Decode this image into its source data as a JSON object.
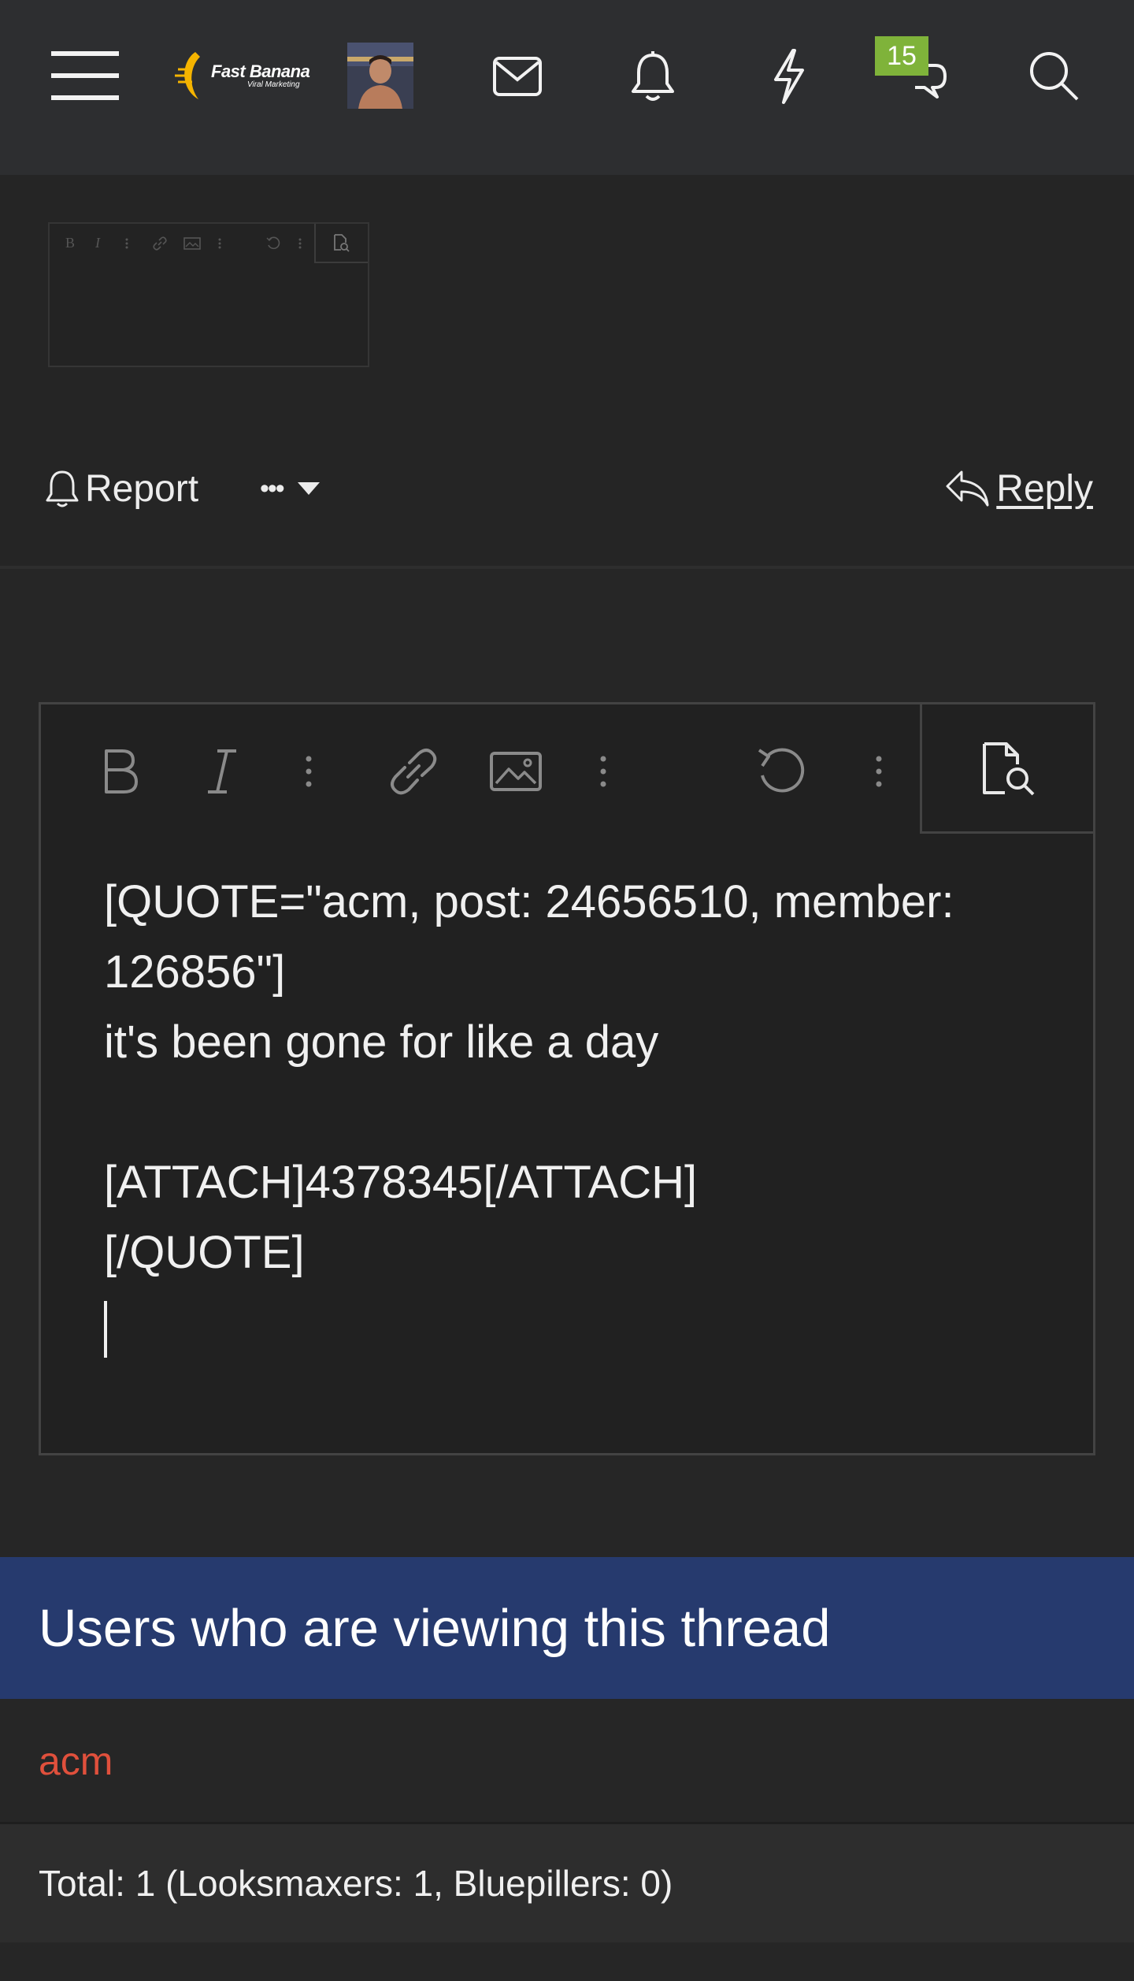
{
  "header": {
    "logo_text": "Fast Banana",
    "logo_subtext": "Viral Marketing",
    "chat_badge": "15"
  },
  "post_actions": {
    "report_label": "Report",
    "more_glyph": "•••",
    "reply_label": "Reply"
  },
  "editor": {
    "content": "[QUOTE=\"acm, post: 24656510, member: 126856\"]\nit's been gone for like a day\n\n[ATTACH]4378345[/ATTACH]\n[/QUOTE]\n",
    "toolbar": [
      "bold-icon",
      "italic-icon",
      "more-text-options-icon",
      "link-icon",
      "image-icon",
      "more-insert-options-icon",
      "undo-icon",
      "more-options-icon",
      "preview-icon"
    ]
  },
  "mini_editor": {
    "bold": "B",
    "italic": "I"
  },
  "viewers": {
    "title": "Users who are viewing this thread",
    "users": [
      "acm"
    ],
    "total": "Total: 1 (Looksmaxers: 1, Bluepillers: 0)"
  },
  "colors": {
    "topbar": "#2d2e30",
    "accent_blue": "#263a6e",
    "badge_green": "#7fb33a",
    "username_red": "#e0503c"
  }
}
